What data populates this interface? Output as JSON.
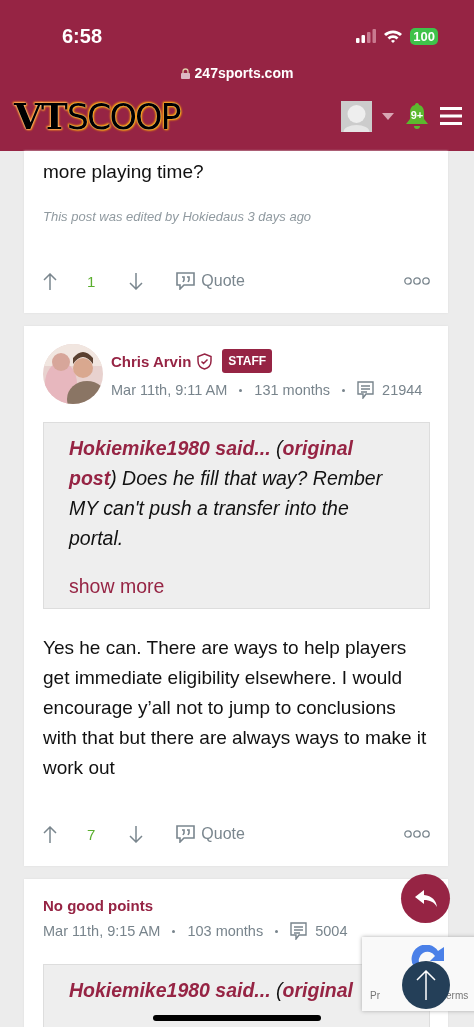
{
  "status_bar": {
    "time": "6:58",
    "battery": "100"
  },
  "address_bar": {
    "url": "247sports.com"
  },
  "site_header": {
    "logo_bold": "VT",
    "logo_rest": "SCOOP",
    "notification_count": "9+"
  },
  "posts": [
    {
      "kind": "tail",
      "body": "more playing time?",
      "edit_note": "This post was edited by Hokiedaus 3 days ago",
      "votes": "1",
      "quote_label": "Quote"
    },
    {
      "kind": "full",
      "author": "Chris Arvin",
      "verified": true,
      "badge": "STAFF",
      "date": "Mar 11th, 9:11 AM",
      "tenure": "131 months",
      "post_count": "21944",
      "quote": {
        "text": "**Hokiemike1980 said...** (**original post**) Does he fill that way? Rember MY can't push a transfer into the portal.",
        "show_more": "show more"
      },
      "body": "Yes he can. There are ways to help players get immediate eligibility elsewhere. I would encourage y’all not to jump to conclusions with that but there are always ways to make it work out",
      "votes": "7",
      "quote_label": "Quote"
    },
    {
      "kind": "head",
      "author": "No good points",
      "verified": false,
      "date": "Mar 11th, 9:15 AM",
      "tenure": "103 months",
      "post_count": "5004",
      "quote": {
        "text": "**Hokiemike1980 said...** (**original**"
      }
    }
  ],
  "recaptcha": {
    "left": "Pr",
    "right": "erms"
  }
}
